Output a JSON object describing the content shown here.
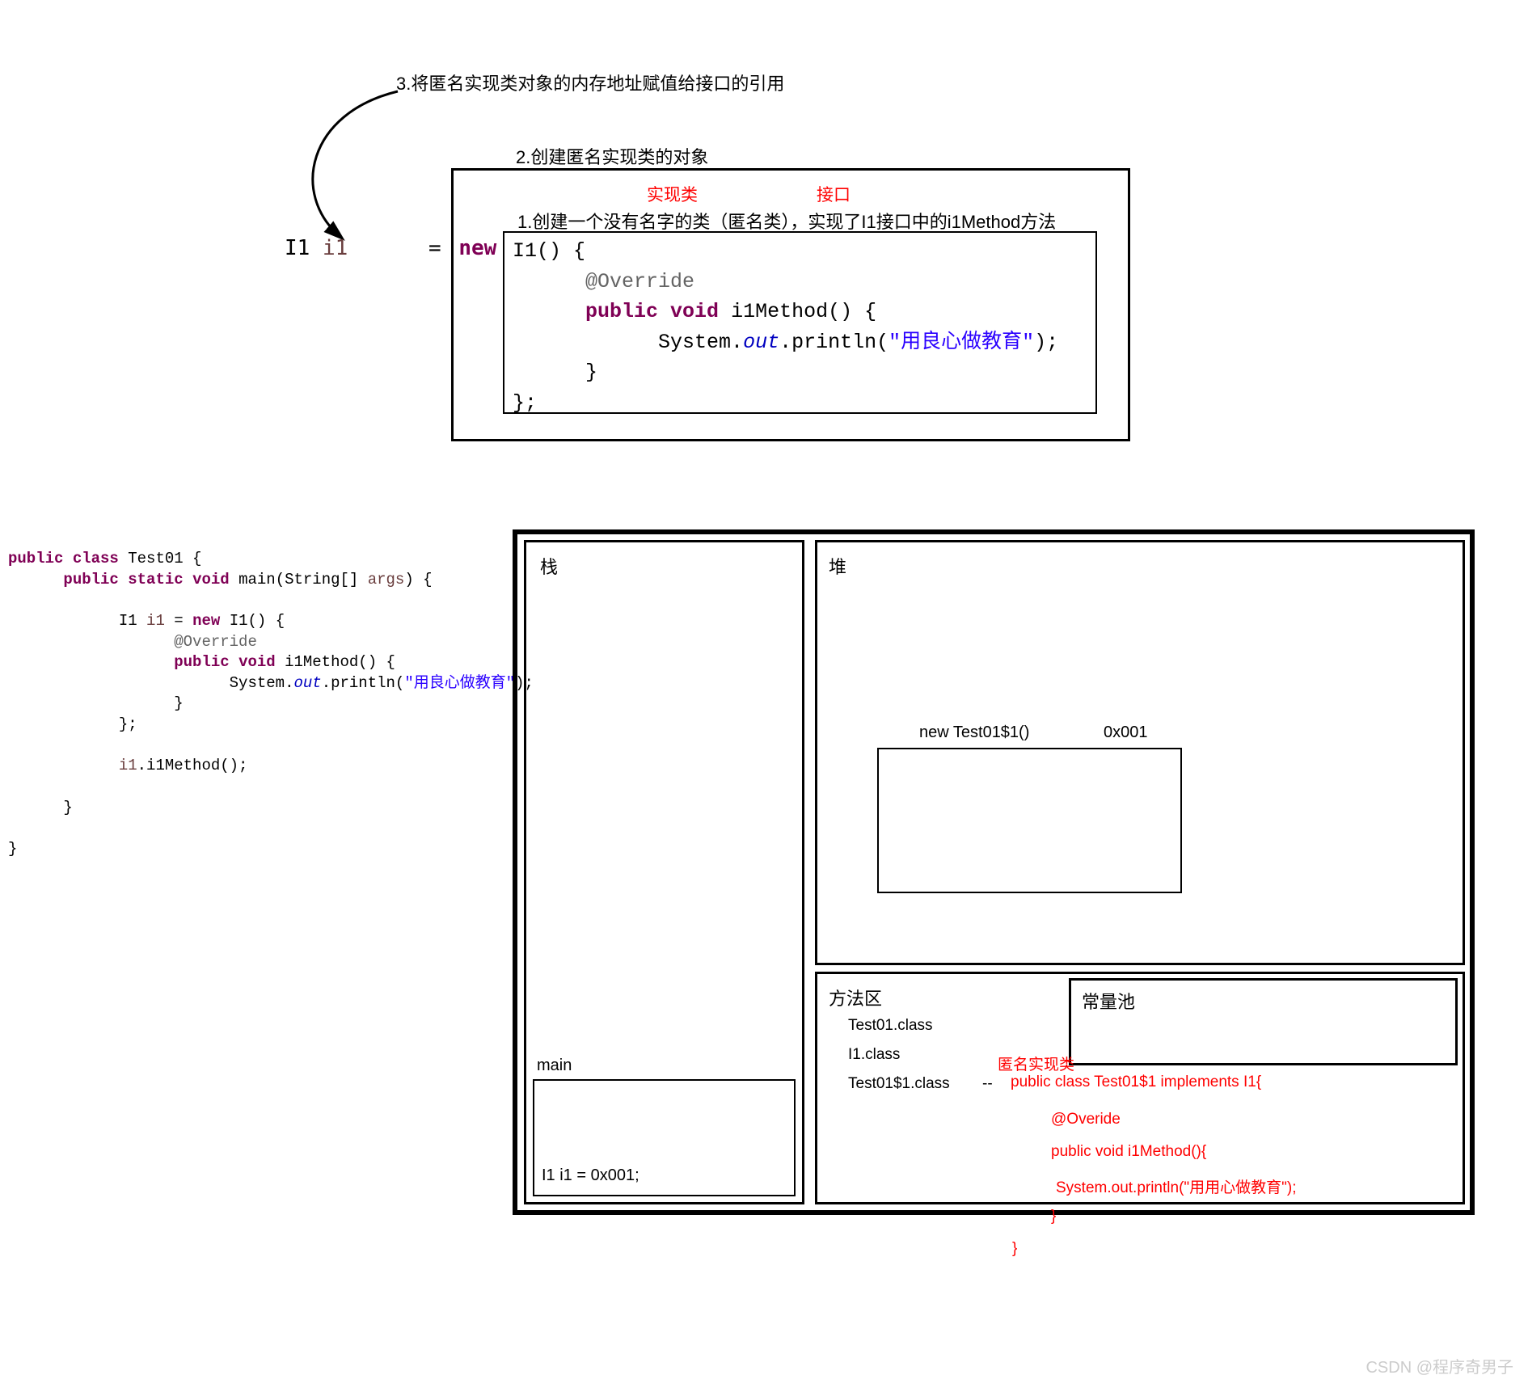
{
  "top": {
    "step3": "3.将匿名实现类对象的内存地址赋值给接口的引用",
    "step2": "2.创建匿名实现类的对象",
    "impl_label": "实现类",
    "intf_label": "接口",
    "step1": "1.创建一个没有名字的类（匿名类），实现了I1接口中的i1Method方法",
    "decl_type": "I1",
    "decl_name": "i1",
    "decl_eq": "=",
    "decl_new": "new",
    "code_l1_pre": "I1() {",
    "code_l2_anno": "@Override",
    "code_l3_pub": "public",
    "code_l3_void": "void",
    "code_l3_rest": " i1Method() {",
    "code_l4_pre": "System.",
    "code_l4_out": "out",
    "code_l4_mid": ".println(",
    "code_l4_str": "\"用良心做教育\"",
    "code_l4_post": ");",
    "code_l5": "}",
    "code_l6": "};"
  },
  "lower_code": {
    "l1_pub": "public",
    "l1_class": "class",
    "l1_rest": " Test01 {",
    "l2_pub": "public",
    "l2_static": "static",
    "l2_void": "void",
    "l2_main": " main(String[] ",
    "l2_args": "args",
    "l2_end": ") {",
    "l3_pre": "I1 ",
    "l3_var": "i1",
    "l3_eq": " = ",
    "l3_new": "new",
    "l3_rest": " I1() {",
    "l4_anno": "@Override",
    "l5_pub": "public",
    "l5_void": "void",
    "l5_rest": " i1Method() {",
    "l6_pre": "System.",
    "l6_out": "out",
    "l6_mid": ".println(",
    "l6_str": "\"用良心做教育\"",
    "l6_end": ");",
    "l7": "}",
    "l8": "};",
    "l9_var": "i1",
    "l9_call": ".i1Method();",
    "l10": "}",
    "l11": "}"
  },
  "stack": {
    "title": "栈",
    "frame_title": "main",
    "frame_line": "I1 i1 = 0x001;"
  },
  "heap": {
    "title": "堆",
    "obj_label": "new Test01$1()",
    "obj_addr": "0x001"
  },
  "method_area": {
    "title": "方法区",
    "c1": "Test01.class",
    "c2": "I1.class",
    "c3": "Test01$1.class",
    "dash": "--",
    "anno_label": "匿名实现类",
    "gen_l1": "public class Test01$1 implements I1{",
    "gen_l2": "@Overide",
    "gen_l3": "public void i1Method(){",
    "gen_l4": "System.out.println(\"用用心做教育\");",
    "gen_l5": "}",
    "gen_l6": "}"
  },
  "const_pool": {
    "title": "常量池"
  },
  "watermark": "CSDN @程序奇男子"
}
